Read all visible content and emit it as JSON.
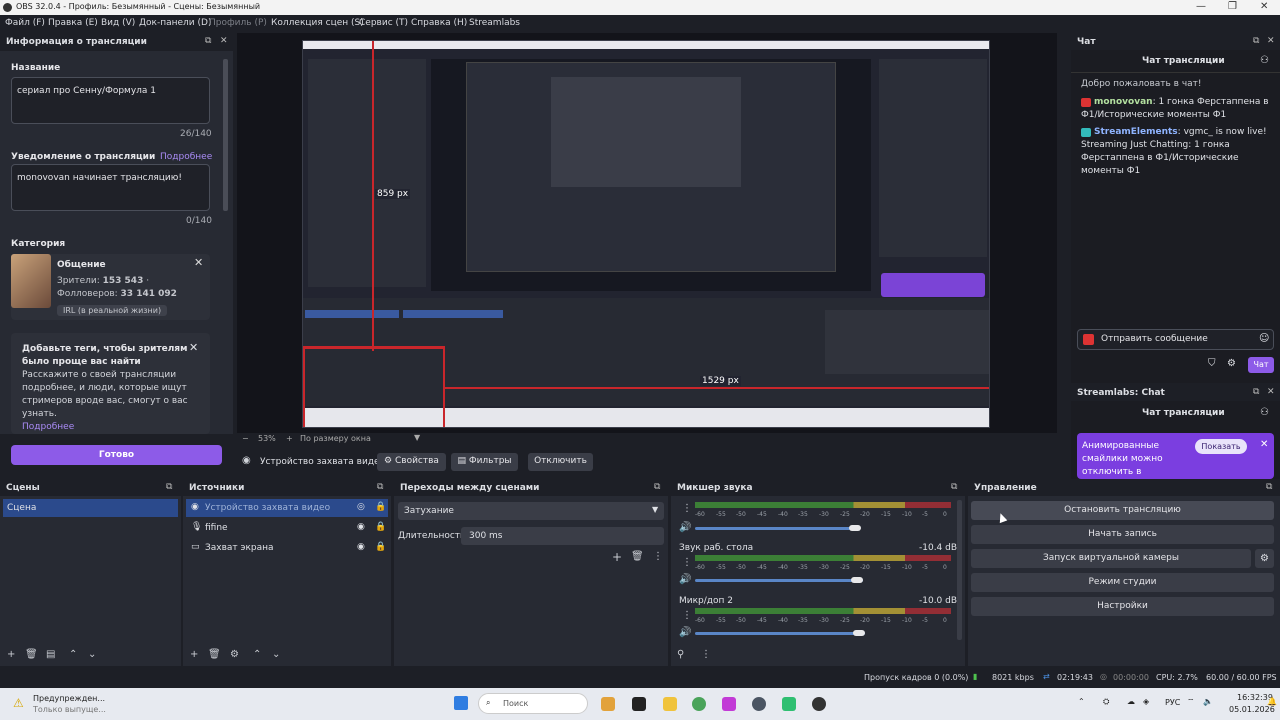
{
  "app": {
    "title": "OBS 32.0.4 - Профиль: Безымянный - Сцены: Безымянный",
    "menu": [
      "Файл (F)",
      "Правка (E)",
      "Вид (V)",
      "Док-панели (D)",
      "Профиль (P)",
      "Коллекция сцен (S)",
      "Сервис (T)",
      "Справка (H)",
      "Streamlabs"
    ]
  },
  "info": {
    "title": "Информация о трансляции",
    "name_label": "Название",
    "name_value": "сериал про Сенну/Формула 1",
    "name_count": "26/140",
    "notice_label": "Уведомление о трансляции",
    "more": "Подробнее",
    "notice_value": "monovovan начинает трансляцию!",
    "notice_count": "0/140",
    "category_label": "Категория",
    "category_name": "Общение",
    "viewers_label": "Зрители:",
    "viewers": "153 543",
    "followers_label": "Фолловеров:",
    "followers": "33 141 092",
    "tag": "IRL (в реальной жизни)",
    "tip_title": "Добавьте теги, чтобы зрителям было проще вас найти",
    "tip_text": "Расскажите о своей трансляции подробнее, и люди, которые ищут стримеров вроде вас, смогут о вас узнать.",
    "tip_more": "Подробнее",
    "done": "Готово"
  },
  "preview": {
    "px1": "859 px",
    "px2": "1529 px",
    "zoom": "53%",
    "fit": "По размеру окна"
  },
  "source_bar": {
    "source": "Устройство захвата видео",
    "props": "Свойства",
    "filters": "Фильтры",
    "disable": "Отключить"
  },
  "chat": {
    "dock_title": "Чат",
    "header": "Чат трансляции",
    "welcome": "Добро пожаловать в чат!",
    "msgs": [
      {
        "user": "monovovan",
        "text": ": 1 гонка Ферстаппена в Ф1/Исторические моменты Ф1",
        "color": "#b3e0a0"
      },
      {
        "user": "StreamElements",
        "text": ": vgmc_ is now live! Streaming Just Chatting: 1 гонка Ферстаппена в Ф1/Исторические моменты Ф1",
        "color": "#8fb4ff"
      }
    ],
    "send_placeholder": "Отправить сообщение",
    "send_btn": "Чат"
  },
  "slchat": {
    "dock_title": "Streamlabs: Chat",
    "header": "Чат трансляции",
    "banner": "Анимированные смайлики можно отключить в",
    "show": "Показать"
  },
  "scenes": {
    "title": "Сцены",
    "items": [
      "Сцена"
    ]
  },
  "sources": {
    "title": "Источники",
    "items": [
      "Устройство захвата видео",
      "fifine",
      "Захват экрана"
    ]
  },
  "transitions": {
    "title": "Переходы между сценами",
    "selected": "Затухание",
    "duration_label": "Длительность",
    "duration": "300 ms"
  },
  "mixer": {
    "title": "Микшер звука",
    "ticks": [
      "-60",
      "-55",
      "-50",
      "-45",
      "-40",
      "-35",
      "-30",
      "-25",
      "-20",
      "-15",
      "-10",
      "-5",
      "0"
    ],
    "channels": [
      {
        "name": "",
        "level": ""
      },
      {
        "name": "Звук раб. стола",
        "level": "-10.4 dB"
      },
      {
        "name": "Микр/доп 2",
        "level": "-10.0 dB"
      }
    ]
  },
  "controls": {
    "title": "Управление",
    "buttons": [
      "Остановить трансляцию",
      "Начать запись",
      "Запуск виртуальной камеры",
      "Режим студии",
      "Настройки"
    ]
  },
  "status": {
    "dropped": "Пропуск кадров 0 (0.0%)",
    "bitrate": "8021 kbps",
    "live_time": "02:19:43",
    "rec_time": "00:00:00",
    "cpu": "CPU: 2.7%",
    "fps": "60.00 / 60.00 FPS"
  },
  "taskbar": {
    "notif_title": "Предупрежден...",
    "notif_sub": "Только выпуще...",
    "search": "Поиск",
    "lang": "РУС",
    "time": "16:32:39",
    "date": "05.01.2026"
  },
  "colors": {
    "accent": "#8d5be8",
    "live_red": "#c9262b",
    "selected": "#2b4a8c"
  }
}
